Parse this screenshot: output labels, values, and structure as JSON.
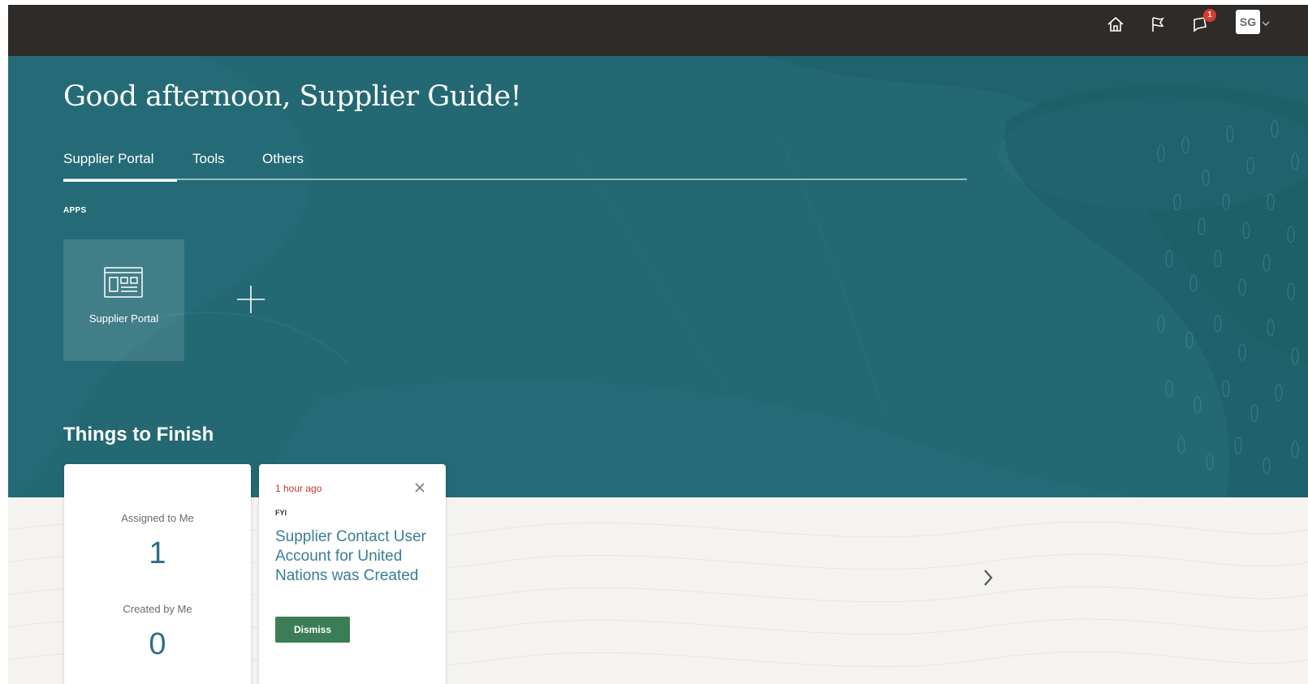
{
  "header": {
    "notification_count": "1",
    "user_initials": "SG"
  },
  "hero": {
    "greeting": "Good afternoon, Supplier Guide!",
    "tabs": [
      {
        "label": "Supplier Portal",
        "active": true
      },
      {
        "label": "Tools",
        "active": false
      },
      {
        "label": "Others",
        "active": false
      }
    ],
    "apps_label": "APPS",
    "apps": [
      {
        "label": "Supplier Portal",
        "icon": "supplier-portal-icon"
      }
    ],
    "things_title": "Things to Finish"
  },
  "things": {
    "counts": {
      "assigned_label": "Assigned to Me",
      "assigned_value": "1",
      "created_label": "Created by Me",
      "created_value": "0"
    },
    "notification": {
      "time": "1 hour ago",
      "type": "FYI",
      "title": "Supplier Contact User Account for United Nations was Created",
      "dismiss_label": "Dismiss"
    }
  },
  "colors": {
    "topbar": "#2e2b28",
    "hero": "#236872",
    "accent_link": "#3a7d93",
    "dismiss": "#3c7d57",
    "time_red": "#c0392b",
    "badge": "#d93b2b"
  }
}
